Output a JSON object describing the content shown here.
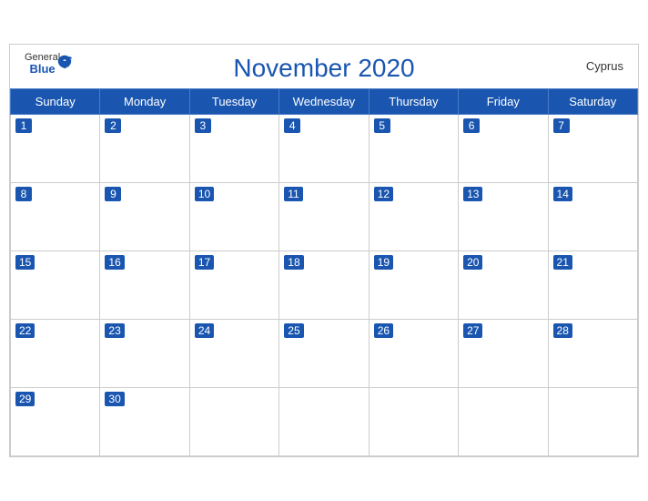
{
  "header": {
    "logo_general": "General",
    "logo_blue": "Blue",
    "title": "November 2020",
    "country": "Cyprus"
  },
  "weekdays": [
    "Sunday",
    "Monday",
    "Tuesday",
    "Wednesday",
    "Thursday",
    "Friday",
    "Saturday"
  ],
  "weeks": [
    [
      {
        "date": "1",
        "empty": false
      },
      {
        "date": "2",
        "empty": false
      },
      {
        "date": "3",
        "empty": false
      },
      {
        "date": "4",
        "empty": false
      },
      {
        "date": "5",
        "empty": false
      },
      {
        "date": "6",
        "empty": false
      },
      {
        "date": "7",
        "empty": false
      }
    ],
    [
      {
        "date": "8",
        "empty": false
      },
      {
        "date": "9",
        "empty": false
      },
      {
        "date": "10",
        "empty": false
      },
      {
        "date": "11",
        "empty": false
      },
      {
        "date": "12",
        "empty": false
      },
      {
        "date": "13",
        "empty": false
      },
      {
        "date": "14",
        "empty": false
      }
    ],
    [
      {
        "date": "15",
        "empty": false
      },
      {
        "date": "16",
        "empty": false
      },
      {
        "date": "17",
        "empty": false
      },
      {
        "date": "18",
        "empty": false
      },
      {
        "date": "19",
        "empty": false
      },
      {
        "date": "20",
        "empty": false
      },
      {
        "date": "21",
        "empty": false
      }
    ],
    [
      {
        "date": "22",
        "empty": false
      },
      {
        "date": "23",
        "empty": false
      },
      {
        "date": "24",
        "empty": false
      },
      {
        "date": "25",
        "empty": false
      },
      {
        "date": "26",
        "empty": false
      },
      {
        "date": "27",
        "empty": false
      },
      {
        "date": "28",
        "empty": false
      }
    ],
    [
      {
        "date": "29",
        "empty": false
      },
      {
        "date": "30",
        "empty": false
      },
      {
        "date": "",
        "empty": true
      },
      {
        "date": "",
        "empty": true
      },
      {
        "date": "",
        "empty": true
      },
      {
        "date": "",
        "empty": true
      },
      {
        "date": "",
        "empty": true
      }
    ]
  ]
}
